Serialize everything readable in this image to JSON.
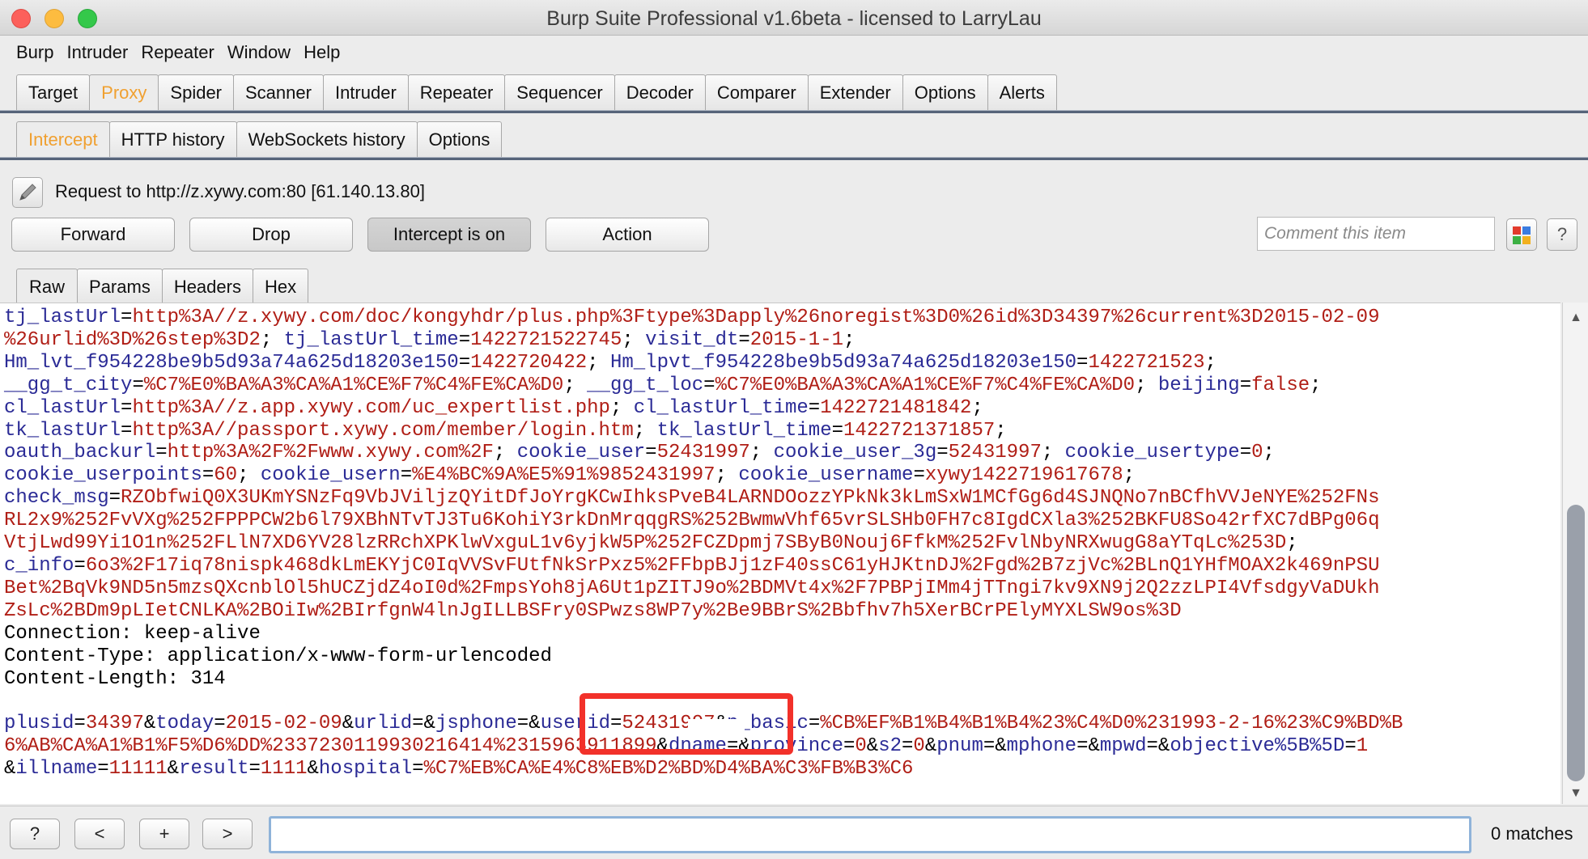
{
  "window": {
    "title": "Burp Suite Professional v1.6beta - licensed to LarryLau"
  },
  "menu": [
    "Burp",
    "Intruder",
    "Repeater",
    "Window",
    "Help"
  ],
  "main_tabs": [
    "Target",
    "Proxy",
    "Spider",
    "Scanner",
    "Intruder",
    "Repeater",
    "Sequencer",
    "Decoder",
    "Comparer",
    "Extender",
    "Options",
    "Alerts"
  ],
  "main_tab_active": "Proxy",
  "proxy_tabs": [
    "Intercept",
    "HTTP history",
    "WebSockets history",
    "Options"
  ],
  "proxy_tab_active": "Intercept",
  "request": {
    "label": "Request to http://z.xywy.com:80  [61.140.13.80]"
  },
  "buttons": {
    "forward": "Forward",
    "drop": "Drop",
    "intercept": "Intercept is on",
    "action": "Action"
  },
  "comment": {
    "placeholder": "Comment this item"
  },
  "help_label": "?",
  "view_tabs": [
    "Raw",
    "Params",
    "Headers",
    "Hex"
  ],
  "view_tab_active": "Raw",
  "code_lines": [
    [
      [
        "k",
        "tj_lastUrl"
      ],
      [
        "p",
        "="
      ],
      [
        "v",
        "http%3A//z.xywy.com/doc/kongyhdr/plus.php%3Ftype%3Dapply%26noregist%3D0%26id%3D34397%26current%3D2015-02-09"
      ]
    ],
    [
      [
        "v",
        "%26urlid%3D%26step%3D2"
      ],
      [
        "p",
        "; "
      ],
      [
        "k",
        "tj_lastUrl_time"
      ],
      [
        "p",
        "="
      ],
      [
        "v",
        "1422721522745"
      ],
      [
        "p",
        "; "
      ],
      [
        "k",
        "visit_dt"
      ],
      [
        "p",
        "="
      ],
      [
        "v",
        "2015-1-1"
      ],
      [
        "p",
        ";"
      ]
    ],
    [
      [
        "k",
        "Hm_lvt_f954228be9b5d93a74a625d18203e150"
      ],
      [
        "p",
        "="
      ],
      [
        "v",
        "1422720422"
      ],
      [
        "p",
        "; "
      ],
      [
        "k",
        "Hm_lpvt_f954228be9b5d93a74a625d18203e150"
      ],
      [
        "p",
        "="
      ],
      [
        "v",
        "1422721523"
      ],
      [
        "p",
        ";"
      ]
    ],
    [
      [
        "k",
        "__gg_t_city"
      ],
      [
        "p",
        "="
      ],
      [
        "v",
        "%C7%E0%BA%A3%CA%A1%CE%F7%C4%FE%CA%D0"
      ],
      [
        "p",
        "; "
      ],
      [
        "k",
        "__gg_t_loc"
      ],
      [
        "p",
        "="
      ],
      [
        "v",
        "%C7%E0%BA%A3%CA%A1%CE%F7%C4%FE%CA%D0"
      ],
      [
        "p",
        "; "
      ],
      [
        "k",
        "beijing"
      ],
      [
        "p",
        "="
      ],
      [
        "v",
        "false"
      ],
      [
        "p",
        ";"
      ]
    ],
    [
      [
        "k",
        "cl_lastUrl"
      ],
      [
        "p",
        "="
      ],
      [
        "v",
        "http%3A//z.app.xywy.com/uc_expertlist.php"
      ],
      [
        "p",
        "; "
      ],
      [
        "k",
        "cl_lastUrl_time"
      ],
      [
        "p",
        "="
      ],
      [
        "v",
        "1422721481842"
      ],
      [
        "p",
        ";"
      ]
    ],
    [
      [
        "k",
        "tk_lastUrl"
      ],
      [
        "p",
        "="
      ],
      [
        "v",
        "http%3A//passport.xywy.com/member/login.htm"
      ],
      [
        "p",
        "; "
      ],
      [
        "k",
        "tk_lastUrl_time"
      ],
      [
        "p",
        "="
      ],
      [
        "v",
        "1422721371857"
      ],
      [
        "p",
        ";"
      ]
    ],
    [
      [
        "k",
        "oauth_backurl"
      ],
      [
        "p",
        "="
      ],
      [
        "v",
        "http%3A%2F%2Fwww.xywy.com%2F"
      ],
      [
        "p",
        "; "
      ],
      [
        "k",
        "cookie_user"
      ],
      [
        "p",
        "="
      ],
      [
        "v",
        "52431997"
      ],
      [
        "p",
        "; "
      ],
      [
        "k",
        "cookie_user_3g"
      ],
      [
        "p",
        "="
      ],
      [
        "v",
        "52431997"
      ],
      [
        "p",
        "; "
      ],
      [
        "k",
        "cookie_usertype"
      ],
      [
        "p",
        "="
      ],
      [
        "v",
        "0"
      ],
      [
        "p",
        ";"
      ]
    ],
    [
      [
        "k",
        "cookie_userpoints"
      ],
      [
        "p",
        "="
      ],
      [
        "v",
        "60"
      ],
      [
        "p",
        "; "
      ],
      [
        "k",
        "cookie_usern"
      ],
      [
        "p",
        "="
      ],
      [
        "v",
        "%E4%BC%9A%E5%91%9852431997"
      ],
      [
        "p",
        "; "
      ],
      [
        "k",
        "cookie_username"
      ],
      [
        "p",
        "="
      ],
      [
        "v",
        "xywy1422719617678"
      ],
      [
        "p",
        ";"
      ]
    ],
    [
      [
        "k",
        "check_msg"
      ],
      [
        "p",
        "="
      ],
      [
        "v",
        "RZObfwiQ0X3UKmYSNzFq9VbJViljzQYitDfJoYrgKCwIhksPveB4LARNDOozzYPkNk3kLmSxW1MCfGg6d4SJNQNo7nBCfhVVJeNYE%252FNs"
      ]
    ],
    [
      [
        "v",
        "RL2x9%252FvVXg%252FPPPCW2b6l79XBhNTvTJ3Tu6KohiY3rkDnMrqqgRS%252BwmwVhf65vrSLSHb0FH7c8IgdCXla3%252BKFU8So42rfXC7dBPg06q"
      ]
    ],
    [
      [
        "v",
        "VtjLwd99Yi1O1n%252FLlN7XD6YV28lzRRchXPKlwVxguL1v6yjkW5P%252FCZDpmj7SByB0Nouj6FfkM%252FvlNbyNRXwugG8aYTqLc%253D"
      ],
      [
        "p",
        ";"
      ]
    ],
    [
      [
        "k",
        "c_info"
      ],
      [
        "p",
        "="
      ],
      [
        "v",
        "6o3%2F17iq78nispk468dkLmEKYjC0IqVVSvFUtfNkSrPxz5%2FFbpBJj1zF40ssC61yHJKtnDJ%2Fgd%2B7zjVc%2BLnQ1YHfMOAX2k469nPSU"
      ]
    ],
    [
      [
        "v",
        "Bet%2BqVk9ND5n5mzsQXcnblOl5hUCZjdZ4oI0d%2FmpsYoh8jA6Ut1pZITJ9o%2BDMVt4x%2F7PBPjIMm4jTTngi7kv9XN9j2Q2zzLPI4VfsdgyVaDUkh"
      ]
    ],
    [
      [
        "v",
        "ZsLc%2BDm9pLIetCNLKA%2BOiIw%2BIrfgnW4lnJgILLBSFry0SPwzs8WP7y%2Be9BBrS%2Bbfhv7h5XerBCrPElyMYXLSW9os%3D"
      ]
    ],
    [
      [
        "p",
        "Connection: keep-alive"
      ]
    ],
    [
      [
        "p",
        "Content-Type: application/x-www-form-urlencoded"
      ]
    ],
    [
      [
        "p",
        "Content-Length: 314"
      ]
    ],
    [
      [
        "p",
        ""
      ]
    ],
    [
      [
        "k",
        "plusid"
      ],
      [
        "p",
        "="
      ],
      [
        "v",
        "34397"
      ],
      [
        "p",
        "&"
      ],
      [
        "k",
        "today"
      ],
      [
        "p",
        "="
      ],
      [
        "v",
        "2015-02-09"
      ],
      [
        "p",
        "&"
      ],
      [
        "k",
        "urlid"
      ],
      [
        "p",
        "=&"
      ],
      [
        "k",
        "jsphone"
      ],
      [
        "p",
        "=&"
      ],
      [
        "k",
        "userid"
      ],
      [
        "p",
        "="
      ],
      [
        "v",
        "52431997"
      ],
      [
        "p",
        "&"
      ],
      [
        "k",
        "p_basic"
      ],
      [
        "p",
        "="
      ],
      [
        "v",
        "%CB%EF%B1%B4%B1%B4%23%C4%D0%231993-2-16%23%C9%BD%B"
      ]
    ],
    [
      [
        "v",
        "6%AB%CA%A1%B1%F5%D6%DD%2337230119930216414%2315963911899"
      ],
      [
        "p",
        "&"
      ],
      [
        "k",
        "dname"
      ],
      [
        "p",
        "=&"
      ],
      [
        "k",
        "province"
      ],
      [
        "p",
        "="
      ],
      [
        "v",
        "0"
      ],
      [
        "p",
        "&"
      ],
      [
        "k",
        "s2"
      ],
      [
        "p",
        "="
      ],
      [
        "v",
        "0"
      ],
      [
        "p",
        "&"
      ],
      [
        "k",
        "pnum"
      ],
      [
        "p",
        "=&"
      ],
      [
        "k",
        "mphone"
      ],
      [
        "p",
        "=&"
      ],
      [
        "k",
        "mpwd"
      ],
      [
        "p",
        "=&"
      ],
      [
        "k",
        "objective%5B%5D"
      ],
      [
        "p",
        "="
      ],
      [
        "v",
        "1"
      ]
    ],
    [
      [
        "p",
        "&"
      ],
      [
        "k",
        "illname"
      ],
      [
        "p",
        "="
      ],
      [
        "v",
        "11111"
      ],
      [
        "p",
        "&"
      ],
      [
        "k",
        "result"
      ],
      [
        "p",
        "="
      ],
      [
        "v",
        "1111"
      ],
      [
        "p",
        "&"
      ],
      [
        "k",
        "hospital"
      ],
      [
        "p",
        "="
      ],
      [
        "v",
        "%C7%EB%CA%E4%C8%EB%D2%BD%D4%BA%C3%FB%B3%C6"
      ]
    ]
  ],
  "bottom": {
    "help": "?",
    "prev": "<",
    "add": "+",
    "next": ">",
    "matches": "0 matches"
  },
  "colors": {
    "key": "#2b2b96",
    "value": "#b01e16",
    "active_tab": "#f0a030",
    "highlight": "#f2312a"
  }
}
